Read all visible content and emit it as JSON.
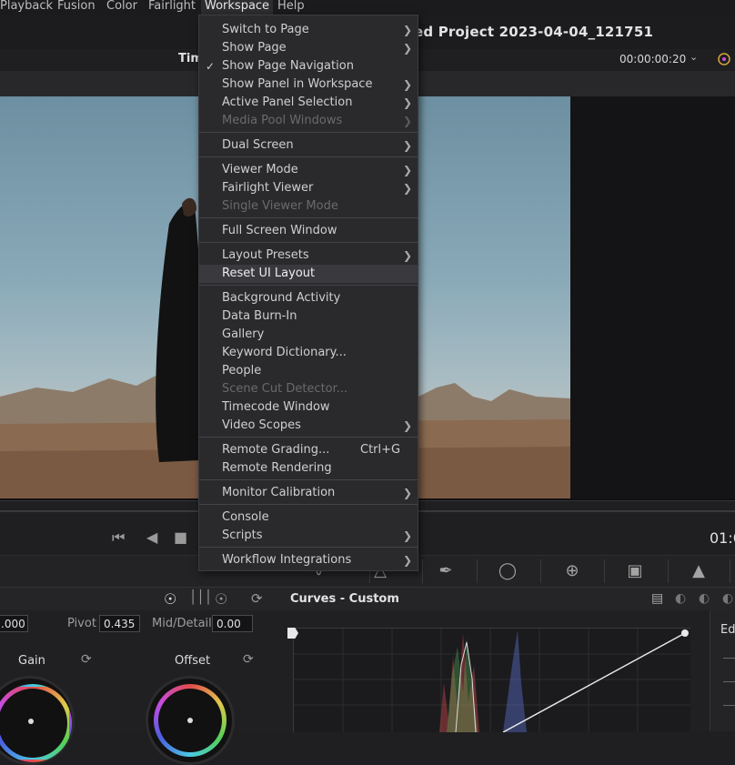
{
  "menubar": {
    "items": [
      "Playback",
      "Fusion",
      "Color",
      "Fairlight",
      "Workspace",
      "Help"
    ],
    "active": "Workspace"
  },
  "title": "ed Project 2023-04-04_121751",
  "viewer": {
    "label": "Tim",
    "timecode": "00:00:00:20",
    "right_timecode": "01:0"
  },
  "menu": {
    "items": [
      {
        "label": "Switch to Page",
        "submenu": true
      },
      {
        "label": "Show Page",
        "submenu": true
      },
      {
        "label": "Show Page Navigation",
        "checked": true
      },
      {
        "label": "Show Panel in Workspace",
        "submenu": true
      },
      {
        "label": "Active Panel Selection",
        "submenu": true
      },
      {
        "label": "Media Pool Windows",
        "submenu": true,
        "disabled": true
      },
      {
        "label": "Dual Screen",
        "submenu": true
      },
      {
        "label": "Viewer Mode",
        "submenu": true
      },
      {
        "label": "Fairlight Viewer",
        "submenu": true
      },
      {
        "label": "Single Viewer Mode",
        "disabled": true
      },
      {
        "label": "Full Screen Window"
      },
      {
        "label": "Layout Presets",
        "submenu": true
      },
      {
        "label": "Reset UI Layout",
        "highlighted": true
      },
      {
        "label": "Background Activity"
      },
      {
        "label": "Data Burn-In"
      },
      {
        "label": "Gallery"
      },
      {
        "label": "Keyword Dictionary..."
      },
      {
        "label": "People"
      },
      {
        "label": "Scene Cut Detector...",
        "disabled": true
      },
      {
        "label": "Timecode Window"
      },
      {
        "label": "Video Scopes",
        "submenu": true
      },
      {
        "label": "Remote Grading...",
        "shortcut": "Ctrl+G"
      },
      {
        "label": "Remote Rendering"
      },
      {
        "label": "Monitor Calibration",
        "submenu": true
      },
      {
        "label": "Console"
      },
      {
        "label": "Scripts",
        "submenu": true
      },
      {
        "label": "Workflow Integrations",
        "submenu": true
      }
    ]
  },
  "color_panel": {
    "curves_title": "Curves - Custom",
    "field0_value": ".000",
    "pivot_label": "Pivot",
    "pivot_value": "0.435",
    "middetail_label": "Mid/Detail",
    "middetail_value": "0.00",
    "gain_label": "Gain",
    "offset_label": "Offset",
    "side_label": "Ed"
  }
}
